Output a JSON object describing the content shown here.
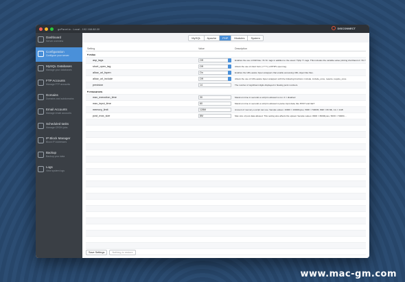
{
  "window": {
    "title": "goPanel.io - Local - 192.168.88.00",
    "disconnect_label": "DISCONNECT",
    "colors": {
      "close": "#ff5f57",
      "minimize": "#febc2e",
      "maximize": "#28c840",
      "accent": "#4a90d9"
    }
  },
  "sidebar": {
    "items": [
      {
        "label": "Dashboard",
        "sub": "Server overview",
        "icon": "dashboard-icon"
      },
      {
        "label": "Configuration",
        "sub": "Configure your server",
        "icon": "configuration-icon"
      },
      {
        "label": "MySQL Databases",
        "sub": "Manage your databases",
        "icon": "database-icon"
      },
      {
        "label": "FTP Accounts",
        "sub": "Manage FTP accounts",
        "icon": "ftp-icon"
      },
      {
        "label": "Domains",
        "sub": "Domains and subdomains",
        "icon": "domains-icon"
      },
      {
        "label": "Email Accounts",
        "sub": "Manage email accounts",
        "icon": "email-icon"
      },
      {
        "label": "Scheduled tasks",
        "sub": "Manage CRON jobs",
        "icon": "clock-icon"
      },
      {
        "label": "IP Block Manager",
        "sub": "Block IP Addresses",
        "icon": "shield-icon"
      },
      {
        "label": "Backup",
        "sub": "Backup your data",
        "icon": "backup-icon"
      },
      {
        "label": "Logs",
        "sub": "View system logs",
        "icon": "logs-icon"
      }
    ]
  },
  "tabs": [
    "MySQL",
    "Apache",
    "PHP",
    "Modules",
    "System"
  ],
  "table": {
    "headers": {
      "setting": "Setting",
      "value": "Value",
      "description": "Description"
    },
    "groups": [
      {
        "name": "misc",
        "rows": [
          {
            "setting": "asp_tags",
            "value": "Off",
            "desc": "Enables the use of ASP-like <% %> tags in addition to the usual <?php ?> tags. This includes the variable-value printing shorthand of <%= $value %>."
          },
          {
            "setting": "short_open_tag",
            "value": "Off",
            "desc": "Allows the use of short form (<? ?>) of PHP's open tag."
          },
          {
            "setting": "allow_url_fopen",
            "value": "On",
            "desc": "Enables the URL-aware fopen wrappers that enable accessing URL object like files."
          },
          {
            "setting": "allow_url_include",
            "value": "Off",
            "desc": "Allows the use of URL-aware fopen wrappers with the following functions: include, include_once, require, require_once."
          },
          {
            "setting": "precision",
            "value": "14",
            "desc": "The number of significant digits displayed in floating point numbers."
          }
        ]
      },
      {
        "name": "resources",
        "rows": [
          {
            "setting": "max_execution_time",
            "value": "30",
            "desc": "Maximum time in seconds a script is allowed to run. 0 = disabled"
          },
          {
            "setting": "max_input_time",
            "value": "60",
            "desc": "Maximum time in seconds a script is allowed to parse input data, like POST and GET"
          },
          {
            "setting": "memory_limit",
            "value": "128M",
            "desc": "Amount of memory a script can use. Sample values: 16000 = 16000bytes, 500K = 500KB, 80M = 80 Mb, 1G = 1GB"
          },
          {
            "setting": "post_max_size",
            "value": "8M",
            "desc": "Max size of post data allowed. This setting also affects file upload. Sample values: 8000 = 8000bytes, 50OK = 500Kb..."
          }
        ]
      }
    ]
  },
  "footer": {
    "save_label": "Save Settings",
    "restore_label": "Nothing to restore"
  },
  "watermark": "www.mac-gm.com"
}
